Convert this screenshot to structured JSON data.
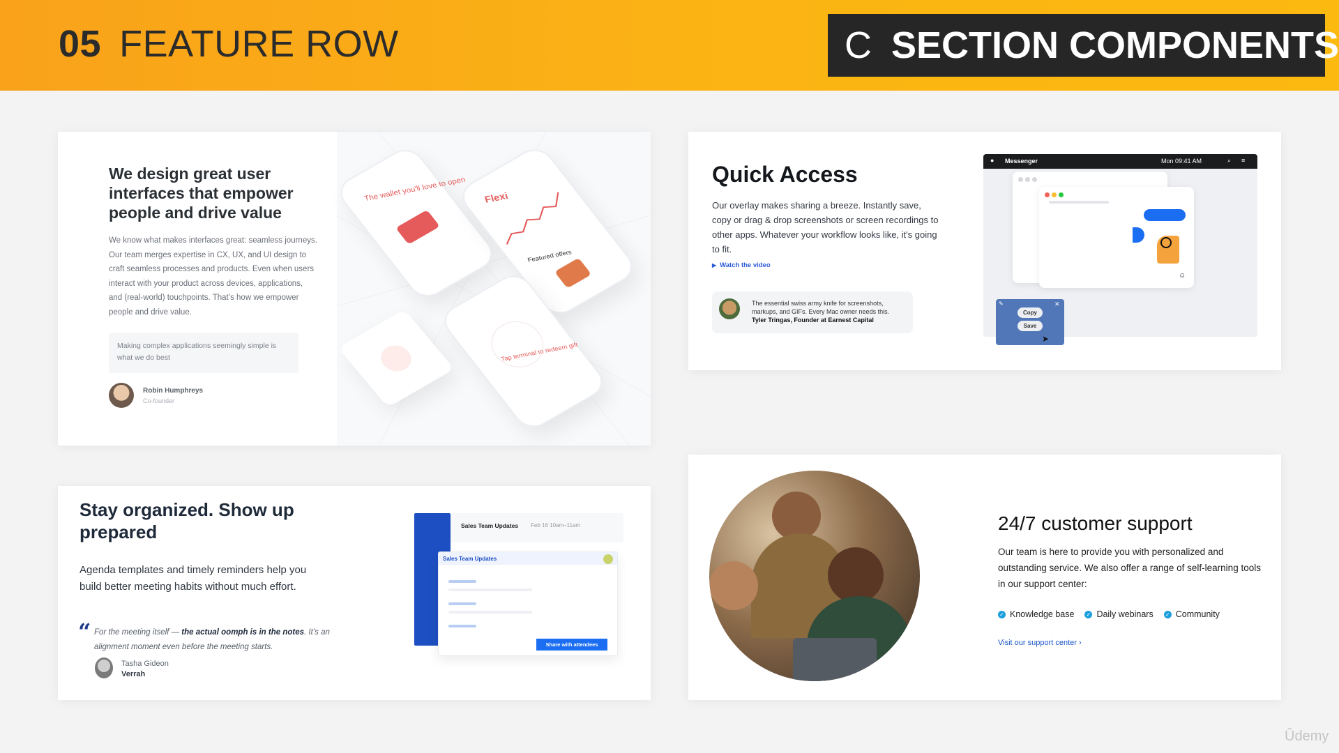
{
  "header": {
    "number": "05",
    "title": "FEATURE ROW",
    "badge_letter": "C",
    "badge_text": "SECTION COMPONENTS"
  },
  "card1": {
    "title": "We design great user interfaces that empower people and drive value",
    "body": "We know what makes interfaces great: seamless journeys. Our team merges expertise in CX, UX, and UI design to craft seamless processes and products. Even when users interact with your product across devices, applications, and (real-world) touchpoints. That’s how we empower people and drive value.",
    "quote": "Making complex applications seemingly simple is what we do best",
    "author_name": "Robin Humphreys",
    "author_role": "Co-founder",
    "mock": {
      "wallet_text": "The wallet you'll love to open",
      "app_name": "Flexi",
      "featured": "Featured offers",
      "redeem": "Tap terminal to redeem gift"
    }
  },
  "card2": {
    "title": "Quick Access",
    "body": "Our overlay makes sharing a breeze. Instantly save, copy or drag & drop screenshots or screen recordings to other apps. Whatever your workflow looks like, it's going to fit.",
    "link": "Watch the video",
    "testimonial_text": "The essential swiss army knife for screenshots, markups, and GIFs. Every Mac owner needs this.",
    "testimonial_author": "Tyler Tringas, Founder at Earnest Capital",
    "mac": {
      "app_label": "Messenger",
      "clock": "Mon 09:41 AM",
      "copy_label": "Copy",
      "save_label": "Save"
    }
  },
  "card3": {
    "title": "Stay organized. Show up prepared",
    "body": "Agenda templates and timely reminders help you build better meeting habits without much effort.",
    "quote_start": "For the meeting itself — ",
    "quote_bold": "the actual oomph is in the notes",
    "quote_end": ". It’s an alignment moment even before the meeting starts.",
    "author_name": "Tasha Gideon",
    "author_company": "Verrah",
    "mock": {
      "top_title": "Sales Team Updates",
      "top_time": "Feb 16 10am–11am",
      "doc_title": "Sales Team Updates",
      "share_button": "Share with attendees"
    }
  },
  "card4": {
    "title": "24/7 customer support",
    "body": "Our team is here to provide you with personalized and outstanding service. We also offer a range of self-learning tools in our support center:",
    "features": [
      "Knowledge base",
      "Daily webinars",
      "Community"
    ],
    "link": "Visit our support center",
    "link_arrow": "›"
  },
  "watermark": "Ûdemy",
  "colors": {
    "banner": "#fbb414",
    "badge": "#262626",
    "link_blue": "#2a5bd7",
    "check_blue": "#1c9fdd",
    "accent_red": "#e55a5a",
    "calendar_blue": "#1e4fc2"
  }
}
